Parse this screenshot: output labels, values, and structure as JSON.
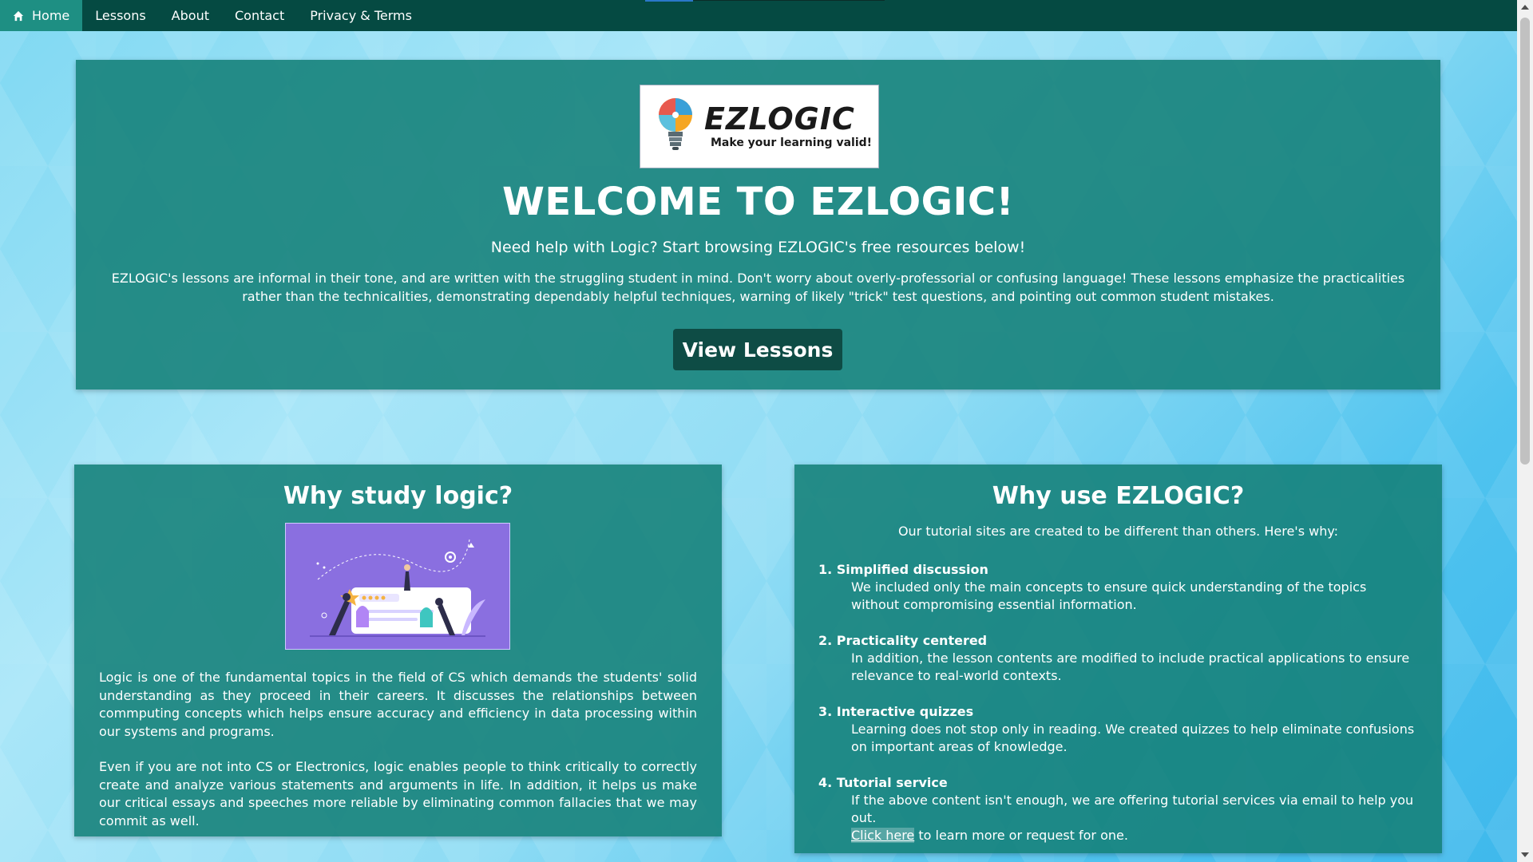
{
  "nav": {
    "items": [
      {
        "label": "Home",
        "active": true,
        "icon": "home-icon"
      },
      {
        "label": "Lessons"
      },
      {
        "label": "About"
      },
      {
        "label": "Contact"
      },
      {
        "label": "Privacy & Terms"
      }
    ]
  },
  "hero": {
    "logo_word": "EZLOGIC",
    "logo_tagline": "Make your learning valid!",
    "title": "WELCOME TO EZLOGIC!",
    "subtitle": "Need help with Logic? Start browsing EZLOGIC's free resources below!",
    "description": "EZLOGIC's lessons are informal in their tone, and are written with the struggling student in mind. Don't worry about overly-professorial or confusing language! These lessons emphasize the practicalities rather than the technicalities, demonstrating dependably helpful techniques, warning of likely \"trick\" test questions, and pointing out common student mistakes.",
    "cta_label": "View Lessons"
  },
  "why_study": {
    "title": "Why study logic?",
    "paragraphs": [
      "Logic is one of the fundamental topics in the field of CS which demands the students' solid understanding as they proceed in their careers. It discusses the relationships between commputing concepts which helps ensure accuracy and efficiency in data processing within our systems and programs.",
      "Even if you are not into CS or Electronics, logic enables people to think critically to correctly create and analyze various statements and arguments in life. In addition, it helps us make our critical essays and speeches more reliable by eliminating common fallacies that we may commit as well."
    ]
  },
  "why_use": {
    "title": "Why use EZLOGIC?",
    "intro": "Our tutorial sites are created to be different than others. Here's why:",
    "reasons": [
      {
        "title": "1. Simplified discussion",
        "text": "We included only the main concepts to ensure quick understanding of the topics without compromising essential information."
      },
      {
        "title": "2. Practicality centered",
        "text": "In addition, the lesson contents are modified to include practical applications to ensure relevance to real-world contexts."
      },
      {
        "title": "3. Interactive quizzes",
        "text": "Learning does not stop only in reading. We created quizzes to help eliminate confusions on important areas of knowledge."
      },
      {
        "title": "4. Tutorial service",
        "text": "If the above content isn't enough, we are offering tutorial services via email to help you out.",
        "link": "Click here",
        "link_suffix": " to learn more or request for one."
      }
    ]
  },
  "colors": {
    "nav_bg": "#054a42",
    "nav_active": "#1e8f83",
    "panel": "#138078",
    "cta_bg": "#0e4c45"
  }
}
